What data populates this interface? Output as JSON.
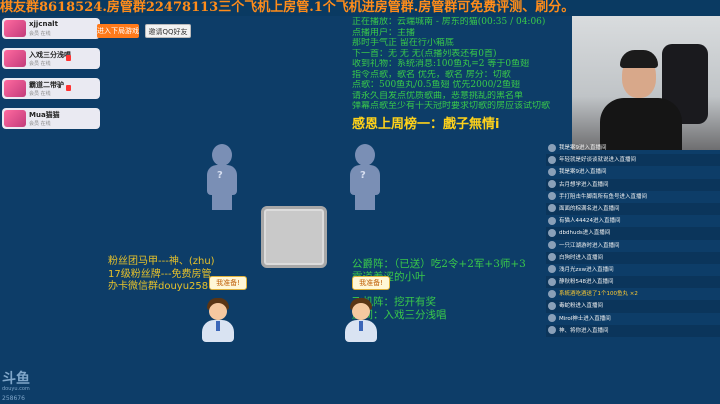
{
  "ticker": {
    "text": "棋友群8618524.房管群22478113三个飞机上房管.1个飞机进房管群.房管群可免费评测、刷分。"
  },
  "lobby": {
    "rooms": [
      {
        "name": "xjjcnalt",
        "sub": "会员 在线"
      },
      {
        "name": "入戏三分浅唱",
        "sub": "会员 在线"
      },
      {
        "name": "霸道二带驴",
        "sub": "会员 在线"
      },
      {
        "name": "Mua猫猫",
        "sub": "会员 在线"
      }
    ],
    "enter_button": "进入下局游戏",
    "invite_button": "邀请QQ好友"
  },
  "notice": {
    "lines": [
      "正在播放：云端城南 - 房东的猫(00:35 / 04:06)",
      "点播用户：主播",
      "那时手气正 留在行小箱底",
      "下一首：无 无 无(点播列表还有0首)",
      "收到礼物：系统消息:100鱼丸=2 等于0鱼翅",
      "指令点歌，歌名 优先，歌名 房分：切歌",
      "点歌：500鱼丸/0.5鱼翅 优先2000/2鱼翅",
      "请永久自发点优质歌曲，恶意挑乱的黑名单",
      "弹幕点歌至少有十天冠时要求切歌的房应该试切歌"
    ],
    "thanks": "感恩上周榜一：戲子無情i"
  },
  "left_info": {
    "lines": [
      "粉丝团马甲---神、(zhu)",
      "17级粉丝牌---免费房管",
      "办卡微信群douyu258"
    ]
  },
  "right_info": {
    "lines": [
      "公爵阵：（已送）吃2令+2军+3师+3",
      "霸道羞涩的小叶",
      "飞机阵：挖开有奖",
      "房间：入戏三分浅唱"
    ]
  },
  "seats": {
    "ready_label": "我准备!"
  },
  "branding": {
    "logo": "斗鱼",
    "logo_sub": "douyu.com",
    "room_number": "258676"
  },
  "chat": {
    "messages": [
      {
        "text": "我是案9进入直播间",
        "gift": ""
      },
      {
        "text": "年轻就是好谈谈就说进入直播间",
        "gift": ""
      },
      {
        "text": "我是案9进入直播间",
        "gift": ""
      },
      {
        "text": "古月想学进入直播间",
        "gift": ""
      },
      {
        "text": "手打阻击牛脚南所有鱼号进入直播间",
        "gift": ""
      },
      {
        "text": "面面的棕满名进入直播间",
        "gift": ""
      },
      {
        "text": "有猫人44424进入直播间",
        "gift": ""
      },
      {
        "text": "dbdhuds进入直播间",
        "gift": ""
      },
      {
        "text": "一只江湖游时进入直播间",
        "gift": ""
      },
      {
        "text": "白狗时进入直播间",
        "gift": ""
      },
      {
        "text": "浅月光zxw进入直播间",
        "gift": ""
      },
      {
        "text": "静秋粉548进入直播间",
        "gift": ""
      },
      {
        "text": "系統酒吃酒送了1个100鱼丸 ×2",
        "gift": "gift"
      },
      {
        "text": "毒蛇粉进入直播间",
        "gift": ""
      },
      {
        "text": "Mirol神士进入直播间",
        "gift": ""
      },
      {
        "text": "神、将你进入直播间",
        "gift": ""
      }
    ]
  },
  "colors": {
    "background": "#0d3d68",
    "ticker": "#ff8c1a",
    "notice": "#39c94a",
    "gold": "#e8c22a"
  }
}
